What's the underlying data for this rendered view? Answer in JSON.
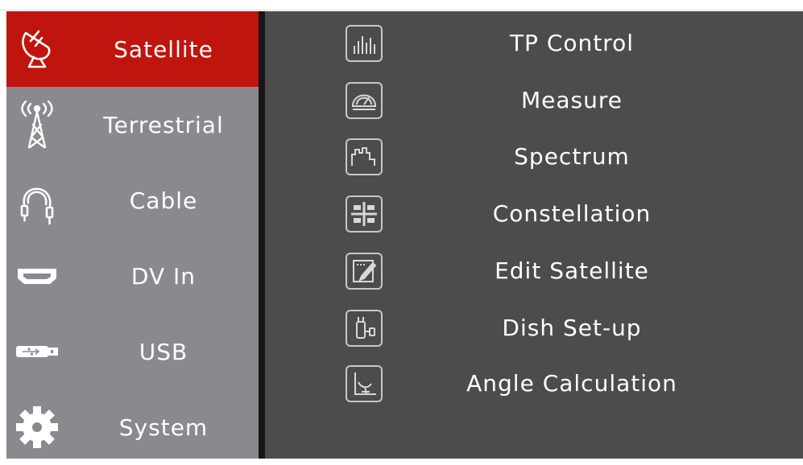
{
  "sidebar": {
    "items": [
      {
        "label": "Satellite",
        "icon": "satellite-dish-icon",
        "active": true
      },
      {
        "label": "Terrestrial",
        "icon": "antenna-tower-icon"
      },
      {
        "label": "Cable",
        "icon": "coax-cable-icon"
      },
      {
        "label": "DV In",
        "icon": "hdmi-port-icon"
      },
      {
        "label": "USB",
        "icon": "usb-stick-icon"
      },
      {
        "label": "System",
        "icon": "gear-icon"
      }
    ]
  },
  "menu": {
    "items": [
      {
        "label": "TP Control",
        "icon": "tp-control-icon"
      },
      {
        "label": "Measure",
        "icon": "measure-gauge-icon"
      },
      {
        "label": "Spectrum",
        "icon": "spectrum-icon"
      },
      {
        "label": "Constellation",
        "icon": "constellation-icon"
      },
      {
        "label": "Edit Satellite",
        "icon": "edit-icon"
      },
      {
        "label": "Dish Set-up",
        "icon": "dish-setup-icon"
      },
      {
        "label": "Angle Calculation",
        "icon": "angle-calculation-icon"
      }
    ]
  },
  "colors": {
    "active": "#c0150e",
    "sidebar": "#8a898d",
    "main": "#4c4c4c"
  }
}
